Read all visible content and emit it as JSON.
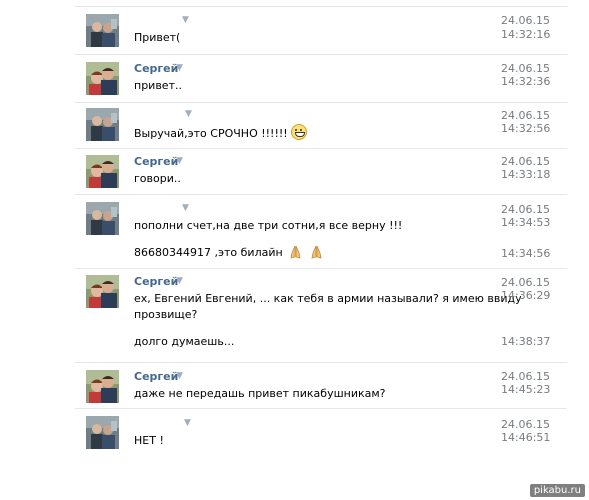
{
  "messages": [
    {
      "sender": "",
      "text": "Привет(",
      "date": "24.06.15",
      "time": "14:32:16"
    },
    {
      "sender": "Сергей",
      "text": "привет..",
      "date": "24.06.15",
      "time": "14:32:36"
    },
    {
      "sender": "",
      "text": "Выручай,это СРОЧНО !!!!!!",
      "date": "24.06.15",
      "time": "14:32:56",
      "emoji": "grinning-face-icon"
    },
    {
      "sender": "Сергей",
      "text": "говори..",
      "date": "24.06.15",
      "time": "14:33:18"
    },
    {
      "sender": "",
      "text": "пополни счет,на две три сотни,я все верну !!!",
      "date": "24.06.15",
      "time": "14:34:53"
    },
    {
      "sender": "",
      "text": "86680344917 ,это билайн",
      "time": "14:34:56",
      "emoji": "praying-hands-icon"
    },
    {
      "sender": "Сергей",
      "text_line1": "ех, Евгений Евгений, ... как тебя в армии называли? я имею ввиду",
      "text_line2": "прозвище?",
      "date": "24.06.15",
      "time": "14:36:29"
    },
    {
      "sender": "",
      "text": "долго думаешь...",
      "time": "14:38:37"
    },
    {
      "sender": "Сергей",
      "text": "даже не передашь привет пикабушникам?",
      "date": "24.06.15",
      "time": "14:45:23"
    },
    {
      "sender": "",
      "text": "НЕТ !",
      "date": "24.06.15",
      "time": "14:46:51"
    }
  ],
  "watermark": "pikabu.ru",
  "colors": {
    "sender_name": "#45688e",
    "timestamp": "#777c80",
    "divider": "#e4e8ed"
  }
}
